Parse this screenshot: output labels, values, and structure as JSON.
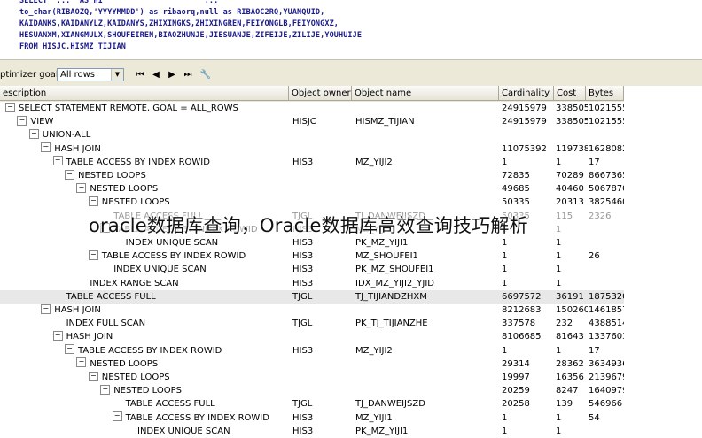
{
  "sql": {
    "lines": [
      "SELECT  ...  AS HI                      ...",
      "to_char(RIBAOZQ,'YYYYMMDD') as ribaorq,null as RIBAOC2RQ,YUANQUID,",
      "KAIDANKS,KAIDANYLZ,KAIDANYS,ZHIXINGKS,ZHIXINGREN,FEIYONGLB,FEIYONGXZ,",
      "HESUANXM,XIANGMULX,SHOUFEIREN,BIAOZHUNJE,JIESUANJE,ZIFEIJE,ZILIJE,YOUHUIJE",
      "FROM HISJC.HISMZ_TIJIAN"
    ]
  },
  "toolbar": {
    "optimizer_label": "ptimizer goal",
    "goal_value": "All rows",
    "buttons": [
      {
        "name": "first-button",
        "glyph": "⏮"
      },
      {
        "name": "prev-button",
        "glyph": "◀"
      },
      {
        "name": "next-button",
        "glyph": "▶"
      },
      {
        "name": "last-button",
        "glyph": "⏭"
      },
      {
        "name": "wrench-button",
        "glyph": "🔧"
      }
    ]
  },
  "columns": [
    "escription",
    "Object owner",
    "Object name",
    "Cardinality",
    "Cost",
    "Bytes"
  ],
  "rows": [
    {
      "indent": 0,
      "toggle": "−",
      "desc": "SELECT STATEMENT REMOTE, GOAL = ALL_ROWS",
      "owner": "",
      "name": "",
      "card": "24915979",
      "cost": "338505",
      "bytes": "1021555"
    },
    {
      "indent": 1,
      "toggle": "−",
      "desc": "VIEW",
      "owner": "HISJC",
      "name": "HISMZ_TIJIAN",
      "card": "24915979",
      "cost": "338505",
      "bytes": "1021555"
    },
    {
      "indent": 2,
      "toggle": "−",
      "desc": "UNION-ALL",
      "owner": "",
      "name": "",
      "card": "",
      "cost": "",
      "bytes": ""
    },
    {
      "indent": 3,
      "toggle": "−",
      "desc": "HASH JOIN",
      "owner": "",
      "name": "",
      "card": "11075392",
      "cost": "119738",
      "bytes": "1628082"
    },
    {
      "indent": 4,
      "toggle": "−",
      "desc": "TABLE ACCESS BY INDEX ROWID",
      "owner": "HIS3",
      "name": "MZ_YIJI2",
      "card": "1",
      "cost": "1",
      "bytes": "17"
    },
    {
      "indent": 5,
      "toggle": "−",
      "desc": "NESTED LOOPS",
      "owner": "",
      "name": "",
      "card": "72835",
      "cost": "70289",
      "bytes": "8667365"
    },
    {
      "indent": 6,
      "toggle": "−",
      "desc": "NESTED LOOPS",
      "owner": "",
      "name": "",
      "card": "49685",
      "cost": "40460",
      "bytes": "5067870"
    },
    {
      "indent": 7,
      "toggle": "−",
      "desc": "NESTED LOOPS",
      "owner": "",
      "name": "",
      "card": "50335",
      "cost": "20313",
      "bytes": "3825460"
    },
    {
      "indent": 8,
      "toggle": "",
      "desc": "TABLE ACCESS FULL",
      "owner": "TJGL",
      "name": "TJ_DANWEIJSZD",
      "card": "50335",
      "cost": "115",
      "bytes": "2326",
      "ghost": true
    },
    {
      "indent": 8,
      "toggle": "−",
      "desc": "TABLE ACCESS BY INDEX ROWID",
      "owner": "HIS3",
      "name": "MZ_YIJI1",
      "card": "1",
      "cost": "1",
      "bytes": "",
      "ghost": true
    },
    {
      "indent": 9,
      "toggle": "",
      "desc": "INDEX UNIQUE SCAN",
      "owner": "HIS3",
      "name": "PK_MZ_YIJI1",
      "card": "1",
      "cost": "1",
      "bytes": ""
    },
    {
      "indent": 7,
      "toggle": "−",
      "desc": "TABLE ACCESS BY INDEX ROWID",
      "owner": "HIS3",
      "name": "MZ_SHOUFEI1",
      "card": "1",
      "cost": "1",
      "bytes": "26"
    },
    {
      "indent": 8,
      "toggle": "",
      "desc": "INDEX UNIQUE SCAN",
      "owner": "HIS3",
      "name": "PK_MZ_SHOUFEI1",
      "card": "1",
      "cost": "1",
      "bytes": ""
    },
    {
      "indent": 6,
      "toggle": "",
      "desc": "INDEX RANGE SCAN",
      "owner": "HIS3",
      "name": "IDX_MZ_YIJI2_YJID",
      "card": "1",
      "cost": "1",
      "bytes": ""
    },
    {
      "indent": 4,
      "toggle": "",
      "desc": "TABLE ACCESS FULL",
      "owner": "TJGL",
      "name": "TJ_TIJIANDZHXM",
      "card": "6697572",
      "cost": "36191",
      "bytes": "1875320",
      "selected": true
    },
    {
      "indent": 3,
      "toggle": "−",
      "desc": "HASH JOIN",
      "owner": "",
      "name": "",
      "card": "8212683",
      "cost": "150260",
      "bytes": "1461857"
    },
    {
      "indent": 4,
      "toggle": "",
      "desc": "INDEX FULL SCAN",
      "owner": "TJGL",
      "name": "PK_TJ_TIJIANZHE",
      "card": "337578",
      "cost": "232",
      "bytes": "4388514"
    },
    {
      "indent": 4,
      "toggle": "−",
      "desc": "HASH JOIN",
      "owner": "",
      "name": "",
      "card": "8106685",
      "cost": "81643",
      "bytes": "1337603"
    },
    {
      "indent": 5,
      "toggle": "−",
      "desc": "TABLE ACCESS BY INDEX ROWID",
      "owner": "HIS3",
      "name": "MZ_YIJI2",
      "card": "1",
      "cost": "1",
      "bytes": "17"
    },
    {
      "indent": 6,
      "toggle": "−",
      "desc": "NESTED LOOPS",
      "owner": "",
      "name": "",
      "card": "29314",
      "cost": "28362",
      "bytes": "3634936"
    },
    {
      "indent": 7,
      "toggle": "−",
      "desc": "NESTED LOOPS",
      "owner": "",
      "name": "",
      "card": "19997",
      "cost": "16356",
      "bytes": "2139679"
    },
    {
      "indent": 8,
      "toggle": "−",
      "desc": "NESTED LOOPS",
      "owner": "",
      "name": "",
      "card": "20259",
      "cost": "8247",
      "bytes": "1640979"
    },
    {
      "indent": 9,
      "toggle": "",
      "desc": "TABLE ACCESS FULL",
      "owner": "TJGL",
      "name": "TJ_DANWEIJSZD",
      "card": "20258",
      "cost": "139",
      "bytes": "546966"
    },
    {
      "indent": 9,
      "toggle": "−",
      "desc": "TABLE ACCESS BY INDEX ROWID",
      "owner": "HIS3",
      "name": "MZ_YIJI1",
      "card": "1",
      "cost": "1",
      "bytes": "54"
    },
    {
      "indent": 10,
      "toggle": "",
      "desc": "INDEX UNIQUE SCAN",
      "owner": "HIS3",
      "name": "PK_MZ_YIJI1",
      "card": "1",
      "cost": "1",
      "bytes": ""
    }
  ],
  "watermark": "oracle数据库查询，Oracle数据库高效查询技巧解析"
}
